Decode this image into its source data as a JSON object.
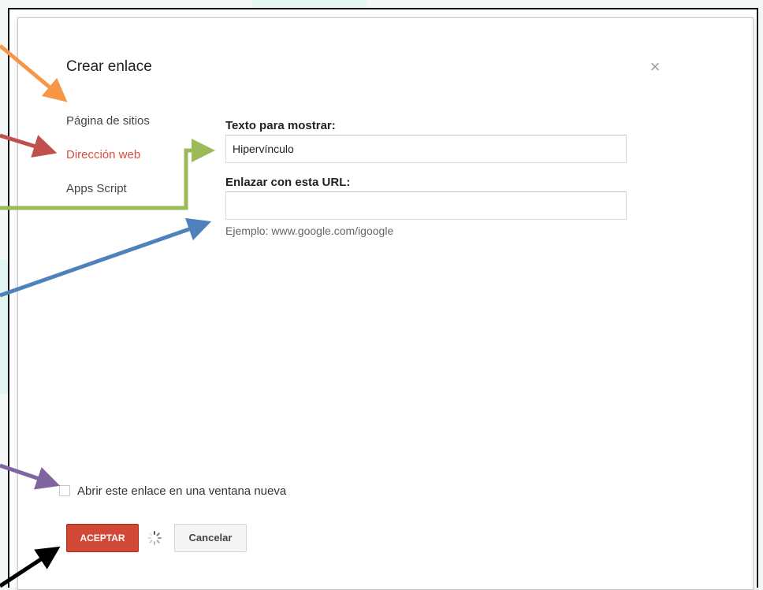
{
  "dialog": {
    "title": "Crear enlace",
    "close_icon": "close-icon"
  },
  "sidebar": {
    "items": [
      {
        "label": "Página de sitios",
        "active": false
      },
      {
        "label": "Dirección web",
        "active": true
      },
      {
        "label": "Apps Script",
        "active": false
      }
    ]
  },
  "form": {
    "display_text_label": "Texto para mostrar:",
    "display_text_value": "Hipervínculo",
    "url_label": "Enlazar con esta URL:",
    "url_value": "",
    "url_hint": "Ejemplo: www.google.com/igoogle"
  },
  "options": {
    "new_window_label": "Abrir este enlace en una ventana nueva",
    "new_window_checked": false
  },
  "buttons": {
    "ok_label": "ACEPTAR",
    "cancel_label": "Cancelar"
  },
  "colors": {
    "accent_red": "#d14836",
    "active_link": "#dd4b39",
    "arrow_orange": "#f79646",
    "arrow_red": "#c0504d",
    "arrow_green": "#9bbb59",
    "arrow_blue": "#4f81bd",
    "arrow_purple": "#8064a2",
    "arrow_black": "#000000"
  }
}
